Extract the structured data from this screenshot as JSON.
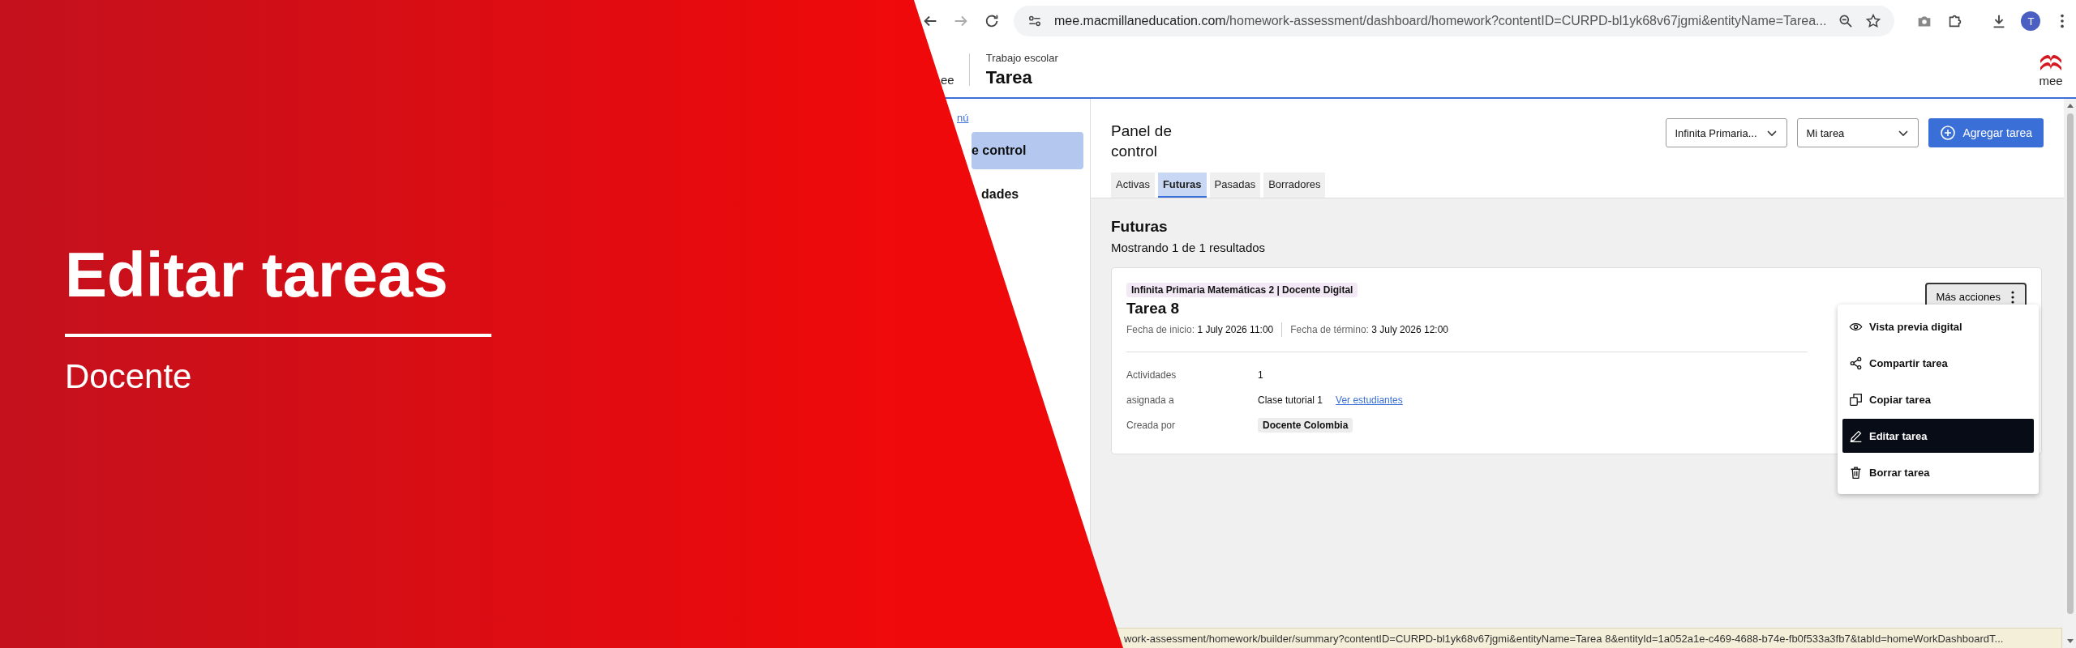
{
  "banner": {
    "title": "Editar tareas",
    "subtitle": "Docente"
  },
  "browser": {
    "url_host": "mee.macmillaneducation.com",
    "url_path": "/homework-assessment/dashboard/homework?contentID=CURPD-bl1yk68v67jgmi&entityName=Tarea...",
    "avatar": "T",
    "status_url": "work-assessment/homework/builder/summary?contentID=CURPD-bl1yk68v67jgmi&entityName=Tarea 8&entityId=1a052a1e-c469-4688-b74e-fb0f533a3fb7&tabId=homeWorkDashboardT..."
  },
  "app_header": {
    "left_logo": "ee",
    "section": "Trabajo escolar",
    "title": "Tarea",
    "right_logo": "mee"
  },
  "sidebar": {
    "link": "nú",
    "items": [
      {
        "label": "e control",
        "selected": true
      },
      {
        "label": "dades",
        "selected": false
      }
    ]
  },
  "panel": {
    "title": "Panel de control",
    "filters": [
      {
        "value": "Infinita Primaria..."
      },
      {
        "value": "Mi tarea"
      }
    ],
    "add_button": "Agregar tarea",
    "tabs": [
      {
        "label": "Activas",
        "selected": false
      },
      {
        "label": "Futuras",
        "selected": true
      },
      {
        "label": "Pasadas",
        "selected": false
      },
      {
        "label": "Borradores",
        "selected": false
      }
    ]
  },
  "results": {
    "heading": "Futuras",
    "summary": "Mostrando 1 de 1 resultados"
  },
  "assignment": {
    "course": "Infinita Primaria Matemáticas 2 | Docente Digital",
    "title": "Tarea 8",
    "start_label": "Fecha de inicio:",
    "start": "1 July 2026 11:00",
    "end_label": "Fecha de término:",
    "end": "3 July 2026 12:00",
    "details": [
      {
        "kind": "text",
        "label": "Actividades",
        "value": "1"
      },
      {
        "kind": "link",
        "label": "asignada a",
        "value": "Clase tutorial 1",
        "link": "Ver estudiantes"
      },
      {
        "kind": "chip",
        "label": "Creada por",
        "value": "Docente Colombia"
      }
    ]
  },
  "actions": {
    "button": "Más acciones",
    "menu": [
      {
        "kind": "preview",
        "label": "Vista previa digital",
        "selected": false
      },
      {
        "kind": "share",
        "label": "Compartir tarea",
        "selected": false
      },
      {
        "kind": "copy",
        "label": "Copiar tarea",
        "selected": false
      },
      {
        "kind": "edit",
        "label": "Editar tarea",
        "selected": true
      },
      {
        "kind": "delete",
        "label": "Borrar tarea",
        "selected": false
      }
    ]
  }
}
